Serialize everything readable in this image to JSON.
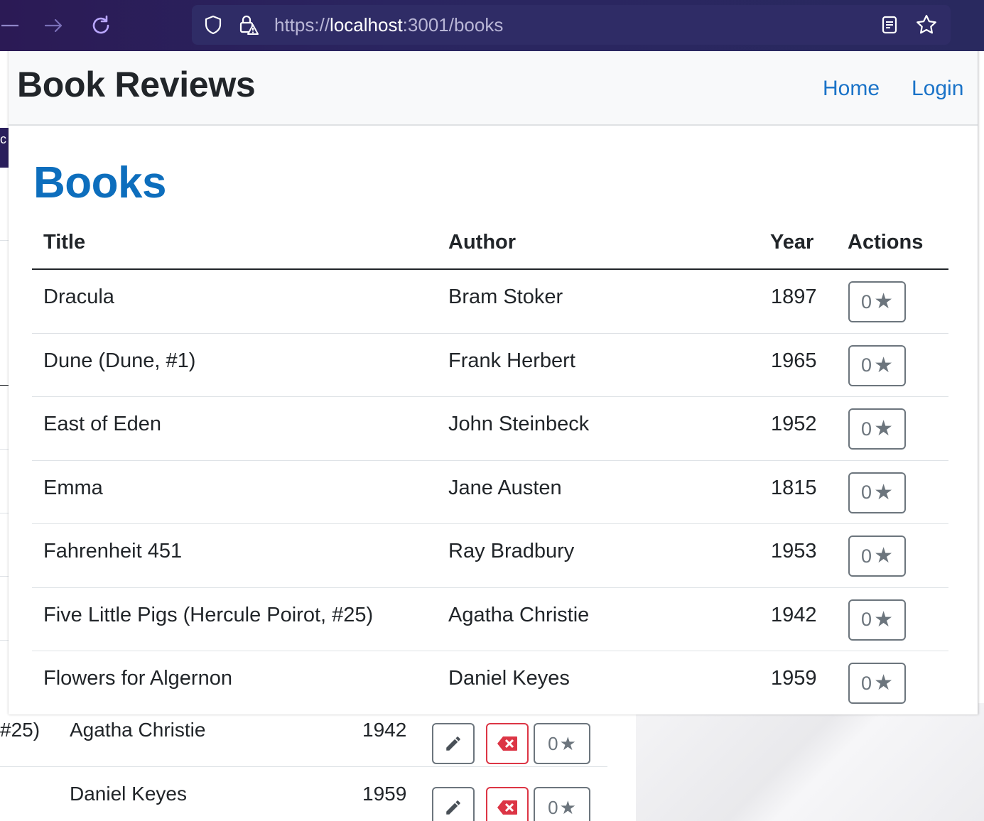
{
  "browser": {
    "url_scheme": "https://",
    "url_host": "localhost",
    "url_rest": ":3001/books"
  },
  "app": {
    "brand": "Book Reviews",
    "nav": {
      "home": "Home",
      "login": "Login"
    }
  },
  "page": {
    "title": "Books",
    "columns": {
      "title": "Title",
      "author": "Author",
      "year": "Year",
      "actions": "Actions"
    },
    "books": [
      {
        "title": "Dracula",
        "author": "Bram Stoker",
        "year": "1897",
        "rating": "0"
      },
      {
        "title": "Dune (Dune, #1)",
        "author": "Frank Herbert",
        "year": "1965",
        "rating": "0"
      },
      {
        "title": "East of Eden",
        "author": "John Steinbeck",
        "year": "1952",
        "rating": "0"
      },
      {
        "title": "Emma",
        "author": "Jane Austen",
        "year": "1815",
        "rating": "0"
      },
      {
        "title": "Fahrenheit 451",
        "author": "Ray Bradbury",
        "year": "1953",
        "rating": "0"
      },
      {
        "title": "Five Little Pigs (Hercule Poirot, #25)",
        "author": "Agatha Christie",
        "year": "1942",
        "rating": "0"
      },
      {
        "title": "Flowers for Algernon",
        "author": "Daniel Keyes",
        "year": "1959",
        "rating": "0"
      }
    ]
  },
  "background_window": {
    "tab_fragment": "c",
    "rows": [
      {
        "title_fragment": "#25)",
        "author": "Agatha Christie",
        "year": "1942",
        "rating": "0"
      },
      {
        "title_fragment": "",
        "author": "Daniel Keyes",
        "year": "1959",
        "rating": "0"
      }
    ]
  },
  "colors": {
    "accent": "#1a73c8",
    "heading": "#0d6ebd",
    "browser_bar": "#2a2560",
    "danger": "#dc3545",
    "secondary": "#6c757d"
  },
  "icons": {
    "back": "back-arrow-icon",
    "forward": "forward-arrow-icon",
    "reload": "reload-icon",
    "shield": "shield-icon",
    "lock": "lock-warning-icon",
    "reader": "reader-view-icon",
    "bookmark": "bookmark-star-icon",
    "star": "star-icon",
    "edit": "pencil-icon",
    "delete": "delete-icon"
  }
}
